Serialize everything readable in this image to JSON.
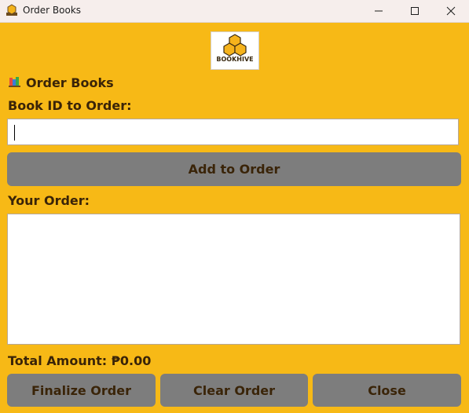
{
  "window": {
    "title": "Order Books"
  },
  "logo": {
    "text": "BOOKHIVE"
  },
  "heading": {
    "title": "Order Books",
    "icon": "books-icon"
  },
  "form": {
    "book_id_label": "Book ID to Order:",
    "book_id_value": "",
    "add_button": "Add to Order",
    "order_label": "Your Order:",
    "order_items": []
  },
  "totals": {
    "label": "Total Amount: ₱0.00"
  },
  "actions": {
    "finalize": "Finalize Order",
    "clear": "Clear Order",
    "close": "Close"
  },
  "colors": {
    "background": "#f7b916",
    "button": "#7d7d7d",
    "text": "#3a2408"
  }
}
